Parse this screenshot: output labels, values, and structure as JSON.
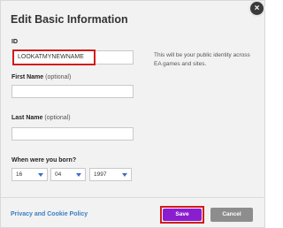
{
  "dialog": {
    "title": "Edit Basic Information",
    "close_symbol": "×"
  },
  "id_field": {
    "label": "ID",
    "value": "LOOKATMYNEWNAME",
    "help": "This will be your public identity across EA games and sites."
  },
  "first_name": {
    "label": "First Name",
    "optional": "(optional)",
    "value": ""
  },
  "last_name": {
    "label": "Last Name",
    "optional": "(optional)",
    "value": ""
  },
  "birth": {
    "label": "When were you born?",
    "day": "16",
    "month": "04",
    "year": "1997"
  },
  "footer": {
    "privacy_link": "Privacy and Cookie Policy",
    "save_label": "Save",
    "cancel_label": "Cancel"
  },
  "colors": {
    "save": "#8a1ecf",
    "highlight": "#d21c1c",
    "link": "#3b7fc4",
    "cancel": "#8d8d8d"
  }
}
